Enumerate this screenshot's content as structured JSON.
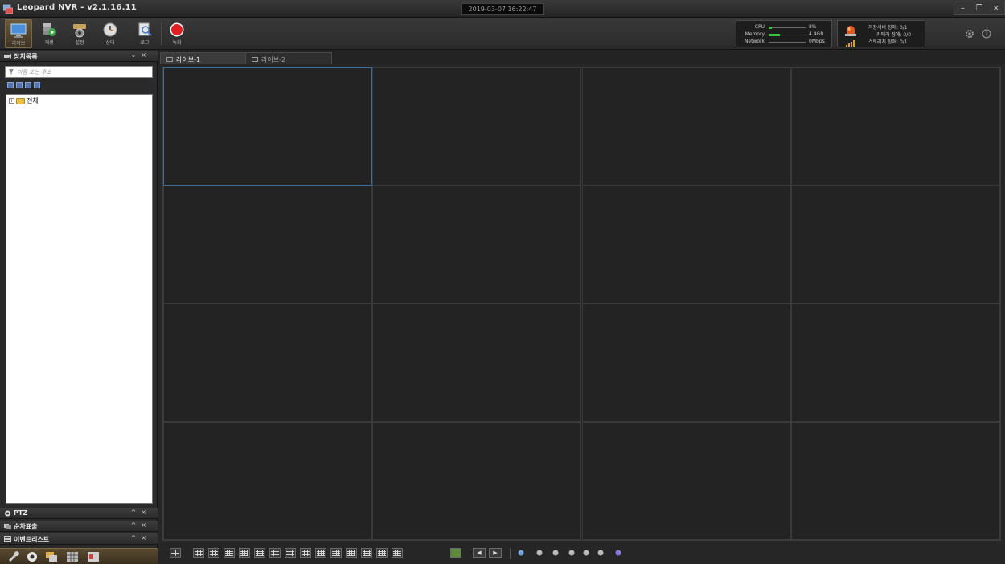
{
  "window": {
    "title": "Leopard NVR - v2.1.16.11",
    "datetime": "2019-03-07 16:22:47",
    "minimize": "–",
    "restore": "❐",
    "close": "×"
  },
  "toolbar": {
    "items": [
      {
        "label": "라이브",
        "icon": "monitor-icon"
      },
      {
        "label": "재생",
        "icon": "playback-icon"
      },
      {
        "label": "설정",
        "icon": "camera-settings-icon"
      },
      {
        "label": "상태",
        "icon": "status-clock-icon"
      },
      {
        "label": "로그",
        "icon": "log-search-icon"
      },
      {
        "label": "녹화",
        "icon": "record-icon"
      }
    ]
  },
  "system_stats": {
    "cpu": {
      "label": "CPU",
      "value": "8%",
      "level": 0.08
    },
    "memory": {
      "label": "Memory",
      "value": "4.4GB",
      "level": 0.3
    },
    "network": {
      "label": "Network",
      "value": "0Mbps",
      "level": 0.0
    }
  },
  "alarm_status": {
    "storage_server": "저장서버 장애: 0/1",
    "camera": "카메라 장애: 0/0",
    "storage": "스토리지 장애: 0/1"
  },
  "device_panel": {
    "title": "장치목록",
    "search_placeholder": "이름 또는 주소",
    "tree_root": "전체"
  },
  "collapsed_panels": [
    {
      "title": "PTZ"
    },
    {
      "title": "순차표출"
    },
    {
      "title": "이벤트리스트"
    }
  ],
  "tabs": [
    {
      "label": "라이브-1",
      "active": true
    },
    {
      "label": "라이브-2",
      "active": false
    }
  ],
  "grid": {
    "rows": 4,
    "cols": 4,
    "selected": [
      0,
      0
    ]
  },
  "colors": {
    "accent_selected": "#3b6fa3",
    "record_red": "#e02020",
    "stat_green": "#34c23a"
  }
}
